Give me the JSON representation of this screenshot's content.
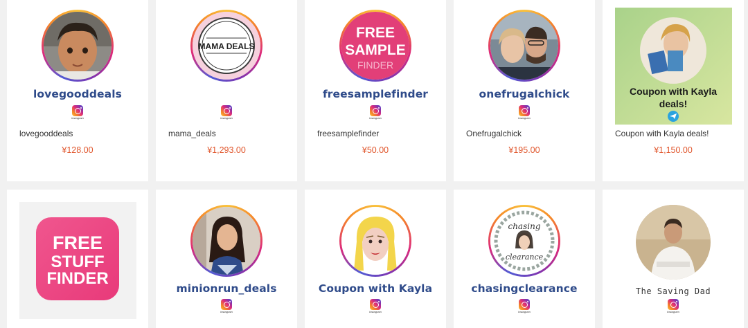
{
  "products": [
    {
      "handle": "lovegooddeals",
      "name": "lovegooddeals",
      "price": "¥128.00",
      "platform": "instagram"
    },
    {
      "handle": "",
      "name": "mama_deals",
      "price": "¥1,293.00",
      "platform": "instagram",
      "logo_text": "MAMA DEALS"
    },
    {
      "handle": "freesamplefinder",
      "name": "freesamplefinder",
      "price": "¥50.00",
      "platform": "instagram",
      "logo_lines": [
        "FREE",
        "SAMPLE",
        "FINDER"
      ]
    },
    {
      "handle": "onefrugalchick",
      "name": "Onefrugalchick",
      "price": "¥195.00",
      "platform": "instagram"
    },
    {
      "name": "Coupon with Kayla deals!",
      "price": "¥1,150.00",
      "platform": "telegram",
      "overlay_text": "Coupon with Kayla deals!"
    },
    {
      "platform": "app",
      "logo_lines": [
        "FREE",
        "STUFF",
        "FINDER"
      ]
    },
    {
      "handle": "minionrun_deals",
      "platform": "instagram"
    },
    {
      "handle": "Coupon with Kayla",
      "platform": "instagram"
    },
    {
      "handle": "chasingclearance",
      "platform": "instagram",
      "logo_lines": [
        "chasing",
        "clearance"
      ]
    },
    {
      "handle": "The Saving Dad",
      "platform": "instagram"
    }
  ],
  "instagram_wordmark": "Instagram",
  "colors": {
    "price": "#e0552b",
    "handle": "#2f4b8a",
    "page_bg": "#f1f1f1"
  }
}
